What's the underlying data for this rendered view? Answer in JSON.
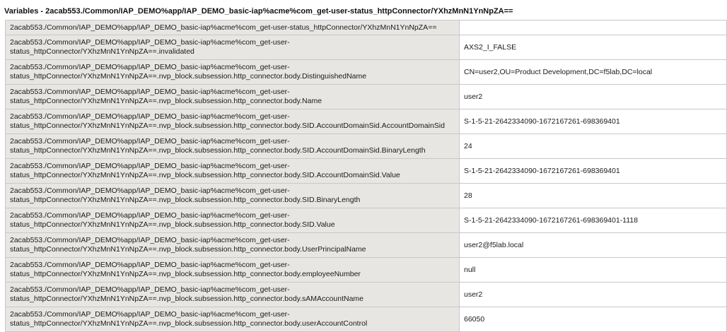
{
  "title": "Variables - 2acab553./Common/IAP_DEMO%app/IAP_DEMO_basic-iap%acme%com_get-user-status_httpConnector/YXhzMnN1YnNpZA==",
  "header_row": {
    "name": "2acab553./Common/IAP_DEMO%app/IAP_DEMO_basic-iap%acme%com_get-user-status_httpConnector/YXhzMnN1YnNpZA==",
    "value": ""
  },
  "rows": [
    {
      "name_line1": "2acab553./Common/IAP_DEMO%app/IAP_DEMO_basic-iap%acme%com_get-user-",
      "name_line2": "status_httpConnector/YXhzMnN1YnNpZA==.invalidated",
      "value": "AXS2_I_FALSE"
    },
    {
      "name_line1": "2acab553./Common/IAP_DEMO%app/IAP_DEMO_basic-iap%acme%com_get-user-",
      "name_line2": "status_httpConnector/YXhzMnN1YnNpZA==.nvp_block.subsession.http_connector.body.DistinguishedName",
      "value": "CN=user2,OU=Product Development,DC=f5lab,DC=local"
    },
    {
      "name_line1": "2acab553./Common/IAP_DEMO%app/IAP_DEMO_basic-iap%acme%com_get-user-",
      "name_line2": "status_httpConnector/YXhzMnN1YnNpZA==.nvp_block.subsession.http_connector.body.Name",
      "value": "user2"
    },
    {
      "name_line1": "2acab553./Common/IAP_DEMO%app/IAP_DEMO_basic-iap%acme%com_get-user-",
      "name_line2": "status_httpConnector/YXhzMnN1YnNpZA==.nvp_block.subsession.http_connector.body.SID.AccountDomainSid.AccountDomainSid",
      "value": "S-1-5-21-2642334090-1672167261-698369401"
    },
    {
      "name_line1": "2acab553./Common/IAP_DEMO%app/IAP_DEMO_basic-iap%acme%com_get-user-",
      "name_line2": "status_httpConnector/YXhzMnN1YnNpZA==.nvp_block.subsession.http_connector.body.SID.AccountDomainSid.BinaryLength",
      "value": "24"
    },
    {
      "name_line1": "2acab553./Common/IAP_DEMO%app/IAP_DEMO_basic-iap%acme%com_get-user-",
      "name_line2": "status_httpConnector/YXhzMnN1YnNpZA==.nvp_block.subsession.http_connector.body.SID.AccountDomainSid.Value",
      "value": "S-1-5-21-2642334090-1672167261-698369401"
    },
    {
      "name_line1": "2acab553./Common/IAP_DEMO%app/IAP_DEMO_basic-iap%acme%com_get-user-",
      "name_line2": "status_httpConnector/YXhzMnN1YnNpZA==.nvp_block.subsession.http_connector.body.SID.BinaryLength",
      "value": "28"
    },
    {
      "name_line1": "2acab553./Common/IAP_DEMO%app/IAP_DEMO_basic-iap%acme%com_get-user-",
      "name_line2": "status_httpConnector/YXhzMnN1YnNpZA==.nvp_block.subsession.http_connector.body.SID.Value",
      "value": "S-1-5-21-2642334090-1672167261-698369401-1118"
    },
    {
      "name_line1": "2acab553./Common/IAP_DEMO%app/IAP_DEMO_basic-iap%acme%com_get-user-",
      "name_line2": "status_httpConnector/YXhzMnN1YnNpZA==.nvp_block.subsession.http_connector.body.UserPrincipalName",
      "value": "user2@f5lab.local"
    },
    {
      "name_line1": "2acab553./Common/IAP_DEMO%app/IAP_DEMO_basic-iap%acme%com_get-user-",
      "name_line2": "status_httpConnector/YXhzMnN1YnNpZA==.nvp_block.subsession.http_connector.body.employeeNumber",
      "value": "null"
    },
    {
      "name_line1": "2acab553./Common/IAP_DEMO%app/IAP_DEMO_basic-iap%acme%com_get-user-",
      "name_line2": "status_httpConnector/YXhzMnN1YnNpZA==.nvp_block.subsession.http_connector.body.sAMAccountName",
      "value": "user2"
    },
    {
      "name_line1": "2acab553./Common/IAP_DEMO%app/IAP_DEMO_basic-iap%acme%com_get-user-",
      "name_line2": "status_httpConnector/YXhzMnN1YnNpZA==.nvp_block.subsession.http_connector.body.userAccountControl",
      "value": "66050"
    }
  ]
}
